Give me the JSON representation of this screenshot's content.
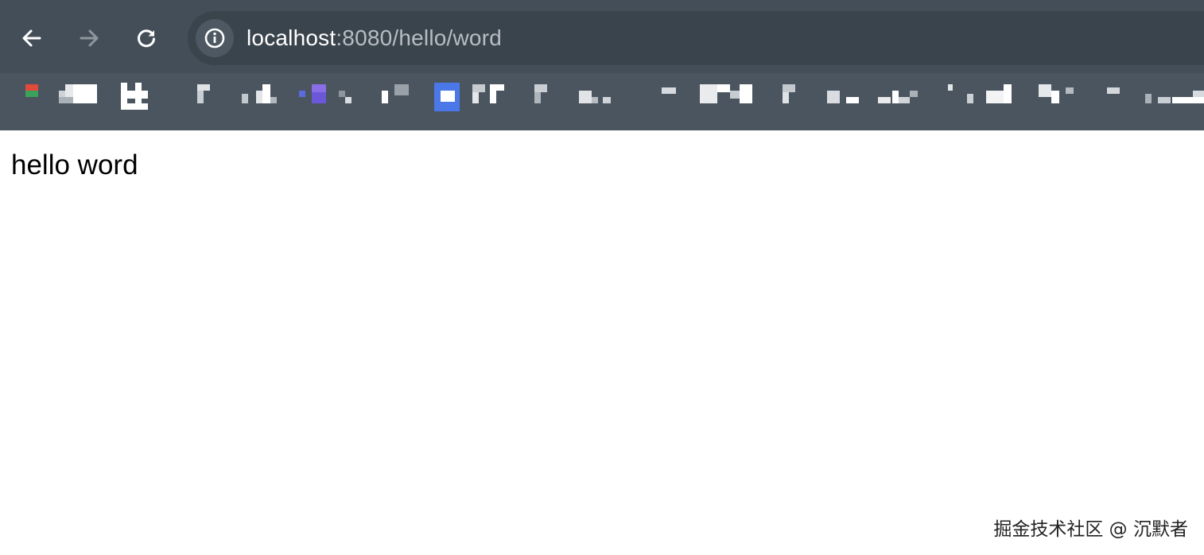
{
  "browser": {
    "url_host": "localhost",
    "url_path": ":8080/hello/word",
    "icons": {
      "back": "arrow-left-icon",
      "forward": "arrow-right-icon",
      "reload": "reload-icon",
      "site_info": "info-icon"
    }
  },
  "page": {
    "text": "hello word"
  },
  "watermark": {
    "text": "掘金技术社区 @ 沉默者"
  },
  "colors": {
    "toolbar": "#434e58",
    "bookmarks_bar": "#4a5560",
    "omnibox": "#3a444d"
  }
}
